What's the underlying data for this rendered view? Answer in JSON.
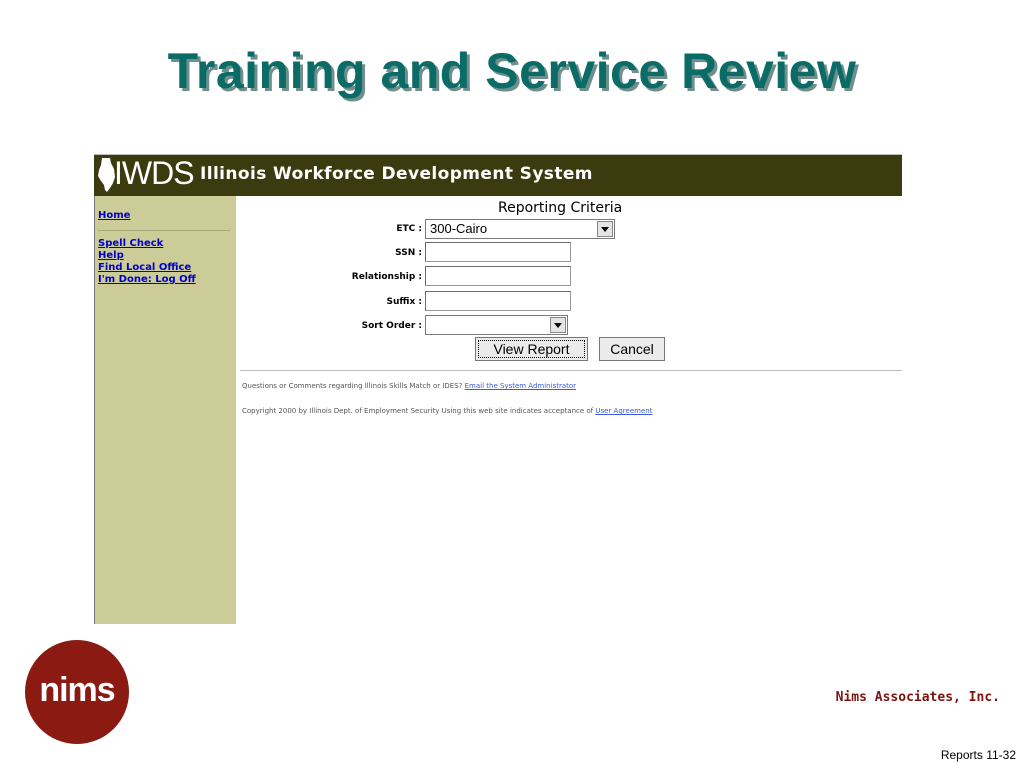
{
  "slide": {
    "title": "Training and Service Review",
    "company": "Nims Associates, Inc.",
    "page_ref": "Reports 11-32",
    "logo_text": "nims"
  },
  "app": {
    "logo_text": "IWDS",
    "system_name": "Illinois Workforce Development System",
    "icons": {
      "state": "illinois-state-icon"
    }
  },
  "sidebar": {
    "items": [
      {
        "label": "Home"
      },
      {
        "label": "Spell Check"
      },
      {
        "label": "Help"
      },
      {
        "label": "Find Local Office"
      },
      {
        "label": "I'm Done: Log Off"
      }
    ]
  },
  "form": {
    "title": "Reporting Criteria",
    "etc": {
      "label": "ETC :",
      "value": "300-Cairo"
    },
    "ssn": {
      "label": "SSN :",
      "value": ""
    },
    "relationship": {
      "label": "Relationship :",
      "value": ""
    },
    "suffix": {
      "label": "Suffix :",
      "value": ""
    },
    "sort_order": {
      "label": "Sort Order :",
      "value": ""
    },
    "view_report_label": "View Report",
    "cancel_label": "Cancel"
  },
  "footer": {
    "questions_text": "Questions or Comments regarding Illinois Skills Match or IDES?",
    "email_link": "Email the System Administrator",
    "copyright_text": "Copyright 2000 by Illinois Dept. of Employment Security Using this web site indicates acceptance of",
    "agreement_link": "User Agreement"
  },
  "colors": {
    "title": "#0b6b67",
    "header_bg": "#3b3b0f",
    "sidebar_bg": "#cccc99",
    "link": "#0000cc",
    "brand": "#8b1a12"
  }
}
